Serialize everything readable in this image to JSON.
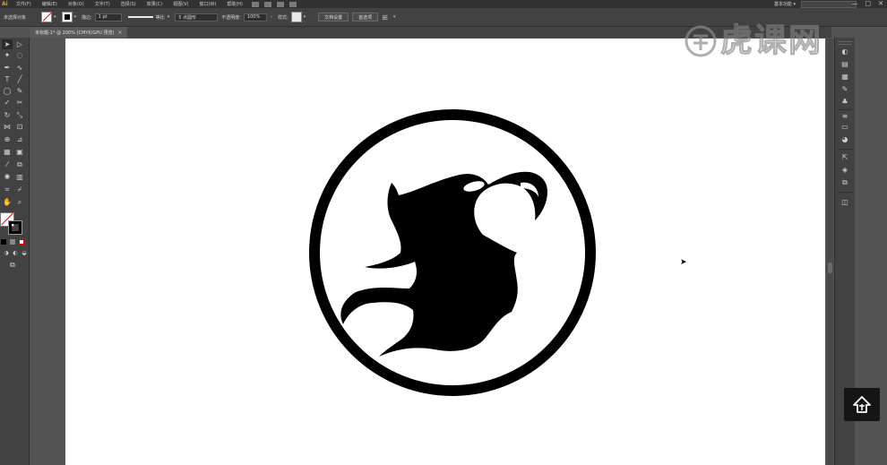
{
  "app": {
    "logo": "Ai"
  },
  "menu": {
    "items": [
      "文件(F)",
      "编辑(E)",
      "对象(O)",
      "文字(T)",
      "选择(S)",
      "效果(C)",
      "视图(V)",
      "窗口(W)",
      "帮助(H)"
    ]
  },
  "workspace": {
    "label": "基本功能 ▾"
  },
  "window_controls": {
    "minimize": "—",
    "maximize": "□",
    "close": "✕"
  },
  "control_bar": {
    "selection_label": "未选择对象",
    "stroke_label": "描边:",
    "stroke_weight": "1 pt",
    "line_style": "等比",
    "brush_label": "5 点圆形",
    "opacity_label": "不透明度:",
    "opacity_value": "100%",
    "style_label": "样式:",
    "doc_setup_button": "文档设置",
    "preferences_button": "首选项"
  },
  "document_tab": {
    "title": "未标题-1* @ 200% (CMYK/GPU 预览)",
    "close": "✕"
  },
  "watermark": {
    "text": "虎课网"
  },
  "colors": {
    "menubar": "#323232",
    "panel": "#424242",
    "pasteboard": "#535353",
    "artboard": "#ffffff",
    "accent_logo": "#ff9a00",
    "artwork": "#000000"
  }
}
